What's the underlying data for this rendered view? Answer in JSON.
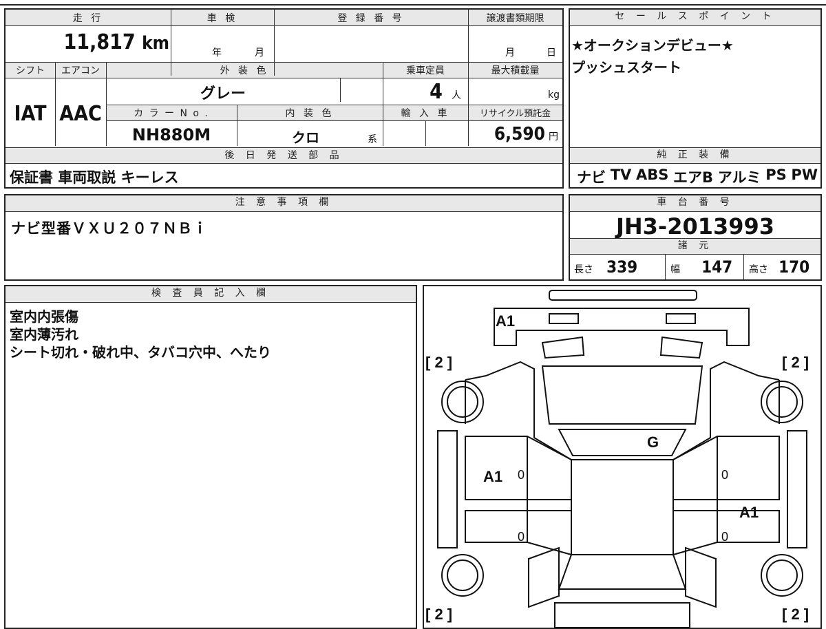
{
  "top_box": {
    "headers": {
      "mileage": "走 行",
      "inspection": "車 検",
      "registration": "登 録 番 号",
      "transfer_deadline": "譲渡書類期限"
    },
    "mileage": {
      "value": "11,817",
      "unit": "km"
    },
    "inspection": {
      "year_unit": "年",
      "month_unit": "月"
    },
    "transfer": {
      "month_unit": "月",
      "day_unit": "日"
    },
    "headers2": {
      "shift": "シフト",
      "aircon": "エアコン",
      "exterior": "外 装 色",
      "capacity": "乗車定員",
      "max_load": "最大積載量"
    },
    "shift": "IAT",
    "aircon": "AAC",
    "exterior_color": "グレー",
    "capacity": {
      "value": "4",
      "unit": "人"
    },
    "max_load_unit": "kg",
    "headers3": {
      "color_no": "カ ラ ー N o .",
      "interior": "内 装 色",
      "import": "輸 入 車",
      "recycle": "リサイクル預託金"
    },
    "color_no": "NH880M",
    "interior": {
      "value": "クロ",
      "unit": "系"
    },
    "recycle": {
      "value": "6,590",
      "unit": "円"
    },
    "later_parts_header": "後 日 発 送 部 品",
    "later_parts": "保証書 車両取説 キーレス"
  },
  "sales": {
    "header": "セ ー ル ス ポ イ ン ト",
    "lines": [
      "★オークションデビュー★",
      "プッシュスタート"
    ]
  },
  "equipment": {
    "header": "純 正 装 備",
    "items": [
      "ナビ",
      "TV",
      "ABS",
      "エアB",
      "アルミ",
      "PS",
      "PW"
    ]
  },
  "notes": {
    "header": "注 意 事 項 欄",
    "text": "ナビ型番ＶＸＵ２０７ＮＢｉ"
  },
  "chassis": {
    "header": "車 台 番 号",
    "number": "JH3-2013993",
    "spec_header": "諸 元",
    "length_label": "長さ",
    "length": "339",
    "width_label": "幅",
    "width": "147",
    "height_label": "高さ",
    "height": "170"
  },
  "inspector": {
    "header": "検 査 員 記 入 欄",
    "lines": [
      "室内内張傷",
      "室内薄汚れ",
      "シート切れ・破れ中、タバコ穴中、へたり"
    ]
  },
  "diagram": {
    "marks": {
      "front": "A1",
      "roof": "G",
      "left_door": "A1",
      "right_door": "A1",
      "corner": "[ 2 ]",
      "zero": "0"
    }
  }
}
